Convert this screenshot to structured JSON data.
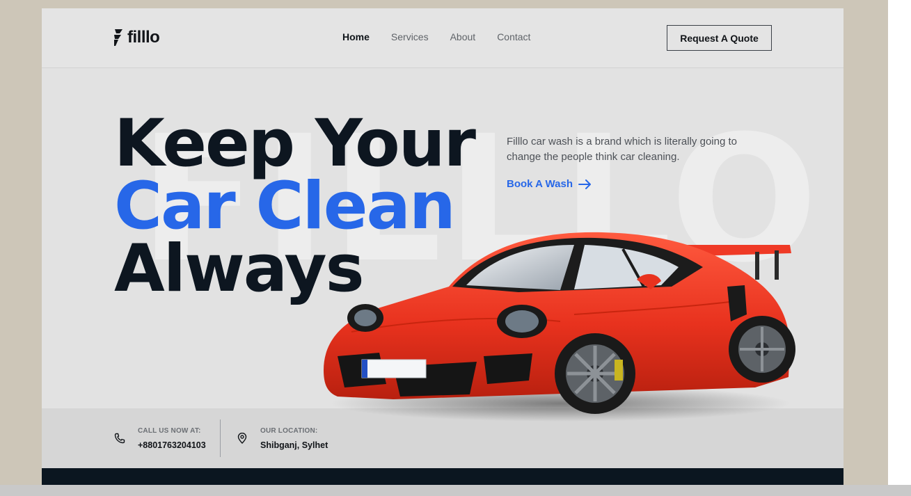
{
  "brand": {
    "name": "filllo"
  },
  "nav": {
    "items": [
      {
        "label": "Home",
        "active": true
      },
      {
        "label": "Services",
        "active": false
      },
      {
        "label": "About",
        "active": false
      },
      {
        "label": "Contact",
        "active": false
      }
    ],
    "cta_label": "Request A Quote"
  },
  "hero": {
    "watermark": "FILLLO",
    "headline": {
      "line1": "Keep Your",
      "line2": "Car Clean",
      "line3": "Always"
    },
    "description": "Filllo car wash is a brand which is literally going to change the  people think car cleaning.",
    "cta_label": "Book A Wash"
  },
  "contact": {
    "phone_label": "CALL US NOW AT:",
    "phone_value": "+8801763204103",
    "location_label": "OUR LOCATION:",
    "location_value": "Shibganj, Sylhet"
  },
  "colors": {
    "accent": "#2767e8",
    "dark": "#0d1620",
    "car_red": "#e8321e",
    "backdrop": "#cdc6b8"
  },
  "icons": {
    "logo": "brand-mark-icon",
    "arrow": "arrow-right-icon",
    "phone": "phone-icon",
    "location": "map-pin-icon"
  }
}
